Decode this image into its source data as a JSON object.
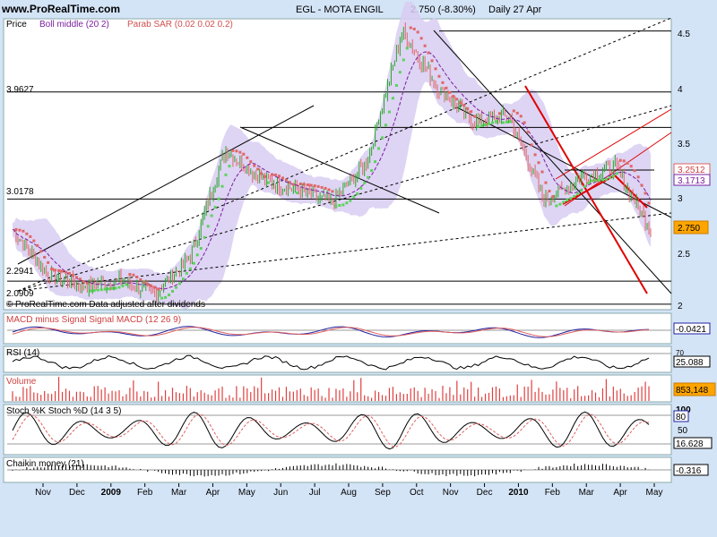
{
  "header": {
    "site": "www.ProRealTime.com",
    "symbol": "EGL - MOTA ENGIL",
    "last": "2.750 (-8.30%)",
    "period": "Daily 27 Apr"
  },
  "colors": {
    "background": "#d4e4f7",
    "panel": "#ffffff",
    "bands": "#d8ccf2",
    "boll_middle": "#7a1fa0",
    "sar_up": "#5bd35b",
    "sar_down": "#e06666",
    "candle": "#2aa62a",
    "candle_down": "#e06666",
    "trend_red": "#e00000",
    "macd": "#2020a0",
    "signal": "#e06060",
    "volume": "#e04040",
    "value_box": "#ffa500"
  },
  "chart_data": [
    {
      "type": "line",
      "panel": "price",
      "title": "EGL - MOTA ENGIL",
      "legend": [
        "Price",
        "Boll middle (20 2)",
        "Parab SAR (0.02 0.02 0.2)"
      ],
      "ylim": [
        2.05,
        4.6
      ],
      "yticks": [
        "2",
        "2.5",
        "3",
        "3.5",
        "4",
        "4.5"
      ],
      "levels": [
        {
          "label": "3.9627",
          "value": 3.9627
        },
        {
          "label": "3.0178",
          "value": 3.0178
        },
        {
          "label": "2.2941",
          "value": 2.2941
        },
        {
          "label": "2.0909",
          "value": 2.0909
        }
      ],
      "value_boxes": [
        "3.2512",
        "3.1713",
        "2.750"
      ],
      "note": "ProRealTime.com Data adjusted after dividends",
      "x_labels": [
        "Nov",
        "Dec",
        "2009",
        "Feb",
        "Mar",
        "Apr",
        "May",
        "Jun",
        "Jul",
        "Aug",
        "Sep",
        "Oct",
        "Nov",
        "Dec",
        "2010",
        "Feb",
        "Mar",
        "Apr",
        "May"
      ],
      "x": [
        "Nov",
        "Dec",
        "2009",
        "Feb",
        "Mar",
        "Apr",
        "May",
        "Jun",
        "Jul",
        "Aug",
        "Sep",
        "Oct",
        "Nov",
        "Dec",
        "2010",
        "Feb",
        "Mar",
        "Apr",
        "May"
      ],
      "close": [
        2.75,
        2.35,
        2.25,
        2.3,
        2.18,
        2.5,
        3.45,
        3.2,
        3.1,
        2.98,
        3.35,
        4.5,
        4.0,
        3.7,
        3.75,
        3.0,
        3.2,
        3.3,
        2.75
      ]
    },
    {
      "type": "line",
      "panel": "macd",
      "title": "MACD minus Signal Signal MACD (12 26 9)",
      "series": [
        {
          "name": "MACD"
        },
        {
          "name": "Signal"
        }
      ],
      "last_value": "-0.0421"
    },
    {
      "type": "line",
      "panel": "rsi",
      "title": "RSI (14)",
      "ref_level": "70",
      "last_value": "25.088"
    },
    {
      "type": "bar",
      "panel": "volume",
      "title": "Volume",
      "last_value": "853,148"
    },
    {
      "type": "line",
      "panel": "stochastic",
      "title": "Stoch %K Stoch %D (14 3 5)",
      "yticks": [
        "100",
        "50"
      ],
      "levels": [
        "80"
      ],
      "last_value": "16.628"
    },
    {
      "type": "area",
      "panel": "chaikin",
      "title": "Chaikin money (21)",
      "last_value": "-0.316"
    }
  ]
}
